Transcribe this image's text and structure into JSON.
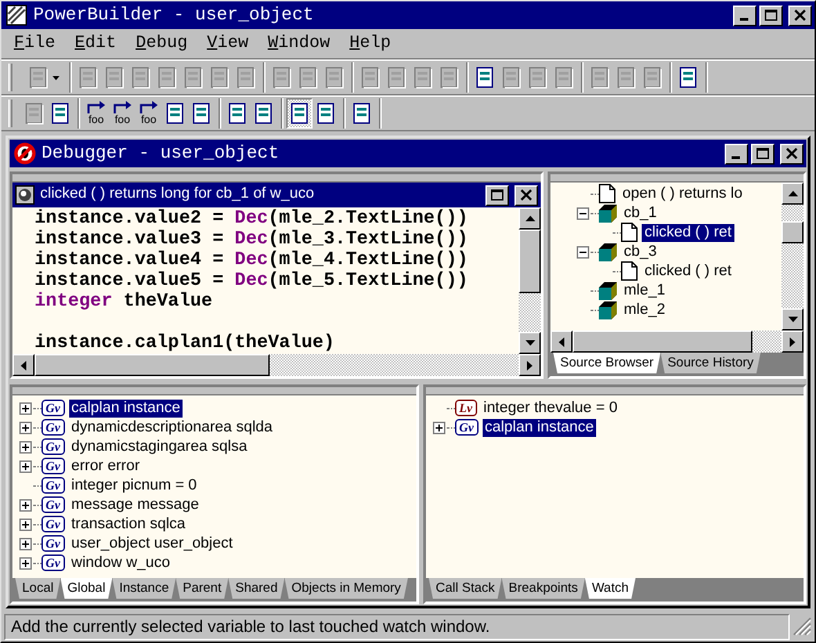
{
  "window": {
    "title": "PowerBuilder - user_object"
  },
  "menu": [
    {
      "label": "File"
    },
    {
      "label": "Edit"
    },
    {
      "label": "Debug"
    },
    {
      "label": "View"
    },
    {
      "label": "Window"
    },
    {
      "label": "Help"
    }
  ],
  "toolbars": [
    {
      "groups": [
        [
          {
            "disabled": true,
            "dropdown": true
          }
        ],
        [
          {
            "disabled": true
          },
          {
            "disabled": true
          },
          {
            "disabled": true
          },
          {
            "disabled": true
          },
          {
            "disabled": true
          },
          {
            "disabled": true
          },
          {
            "disabled": true
          }
        ],
        [
          {
            "disabled": true
          },
          {
            "disabled": true
          },
          {
            "disabled": true
          }
        ],
        [
          {
            "disabled": true
          },
          {
            "disabled": true
          },
          {
            "disabled": true
          },
          {
            "disabled": true
          }
        ],
        [
          {
            "disabled": false
          },
          {
            "disabled": true
          },
          {
            "disabled": true
          },
          {
            "disabled": true
          }
        ],
        [
          {
            "disabled": true
          },
          {
            "disabled": true
          },
          {
            "disabled": true
          }
        ],
        [
          {
            "disabled": false
          }
        ]
      ]
    },
    {
      "groups": [
        [
          {
            "disabled": true
          },
          {
            "disabled": false
          }
        ],
        [
          {
            "disabled": false,
            "caption": "foo"
          },
          {
            "disabled": false,
            "caption": "foo"
          },
          {
            "disabled": false,
            "caption": "foo"
          },
          {
            "disabled": false
          },
          {
            "disabled": false
          }
        ],
        [
          {
            "disabled": false
          },
          {
            "disabled": false
          }
        ],
        [
          {
            "disabled": false,
            "pressed": true
          },
          {
            "disabled": false
          }
        ],
        [
          {
            "disabled": false
          }
        ]
      ]
    }
  ],
  "debugger": {
    "title": "Debugger - user_object",
    "source": {
      "title": "clicked ( ) returns long for cb_1 of w_uco",
      "lines": [
        {
          "segments": [
            {
              "text": "instance.value2 = ",
              "kind": "plain"
            },
            {
              "text": "Dec",
              "kind": "keyword"
            },
            {
              "text": "(mle_2.TextLine())",
              "kind": "plain"
            }
          ]
        },
        {
          "segments": [
            {
              "text": "instance.value3 = ",
              "kind": "plain"
            },
            {
              "text": "Dec",
              "kind": "keyword"
            },
            {
              "text": "(mle_3.TextLine())",
              "kind": "plain"
            }
          ]
        },
        {
          "segments": [
            {
              "text": "instance.value4 = ",
              "kind": "plain"
            },
            {
              "text": "Dec",
              "kind": "keyword"
            },
            {
              "text": "(mle_4.TextLine())",
              "kind": "plain"
            }
          ]
        },
        {
          "segments": [
            {
              "text": "instance.value5 = ",
              "kind": "plain"
            },
            {
              "text": "Dec",
              "kind": "keyword"
            },
            {
              "text": "(mle_5.TextLine())",
              "kind": "plain"
            }
          ]
        },
        {
          "segments": [
            {
              "text": "integer",
              "kind": "keyword"
            },
            {
              "text": " theValue",
              "kind": "plain"
            }
          ]
        },
        {
          "blank_before": true,
          "segments": [
            {
              "text": "instance.calplan1(theValue)",
              "kind": "plain"
            }
          ]
        }
      ]
    },
    "source_browser": {
      "items": [
        {
          "label": "open ( ) returns lo",
          "kind": "event",
          "selected": false
        },
        {
          "label": "cb_1",
          "kind": "control",
          "selected": false,
          "expanded": true,
          "children": [
            {
              "label": "clicked ( ) ret",
              "kind": "event",
              "selected": true
            }
          ]
        },
        {
          "label": "cb_3",
          "kind": "control",
          "selected": false,
          "expanded": true,
          "children": [
            {
              "label": "clicked ( ) ret",
              "kind": "event",
              "selected": false
            }
          ]
        },
        {
          "label": "mle_1",
          "kind": "control",
          "selected": false
        },
        {
          "label": "mle_2",
          "kind": "control",
          "selected": false
        }
      ],
      "tabs": [
        {
          "label": "Source Browser",
          "selected": true
        },
        {
          "label": "Source History",
          "selected": false
        }
      ]
    },
    "variables": {
      "items": [
        {
          "label": "calplan instance",
          "kind": "variable",
          "badge": "Gv",
          "color": "#000080",
          "expanded": false,
          "selected": true
        },
        {
          "label": "dynamicdescriptionarea sqlda",
          "kind": "variable",
          "badge": "Gv",
          "color": "#000080",
          "expanded": false,
          "selected": false
        },
        {
          "label": "dynamicstagingarea sqlsa",
          "kind": "variable",
          "badge": "Gv",
          "color": "#000080",
          "expanded": false,
          "selected": false
        },
        {
          "label": "error error",
          "kind": "variable",
          "badge": "Gv",
          "color": "#000080",
          "expanded": false,
          "selected": false
        },
        {
          "label": "integer picnum = 0",
          "kind": "variable",
          "badge": "Gv",
          "color": "#000080",
          "selected": false
        },
        {
          "label": "message message",
          "kind": "variable",
          "badge": "Gv",
          "color": "#000080",
          "expanded": false,
          "selected": false
        },
        {
          "label": "transaction sqlca",
          "kind": "variable",
          "badge": "Gv",
          "color": "#000080",
          "expanded": false,
          "selected": false
        },
        {
          "label": "user_object user_object",
          "kind": "variable",
          "badge": "Gv",
          "color": "#000080",
          "expanded": false,
          "selected": false
        },
        {
          "label": "window w_uco",
          "kind": "variable",
          "badge": "Gv",
          "color": "#000080",
          "expanded": false,
          "selected": false
        }
      ],
      "tabs": [
        {
          "label": "Local",
          "selected": false
        },
        {
          "label": "Global",
          "selected": true
        },
        {
          "label": "Instance",
          "selected": false
        },
        {
          "label": "Parent",
          "selected": false
        },
        {
          "label": "Shared",
          "selected": false
        },
        {
          "label": "Objects in Memory",
          "selected": false
        }
      ]
    },
    "watch": {
      "items": [
        {
          "label": "integer thevalue = 0",
          "kind": "variable",
          "badge": "Lv",
          "color": "#800000",
          "selected": false
        },
        {
          "label": "calplan instance",
          "kind": "variable",
          "badge": "Gv",
          "color": "#000080",
          "expanded": false,
          "selected": true
        }
      ],
      "tabs": [
        {
          "label": "Call Stack",
          "selected": false
        },
        {
          "label": "Breakpoints",
          "selected": false
        },
        {
          "label": "Watch",
          "selected": true
        }
      ]
    }
  },
  "status_bar": {
    "text": "Add the currently selected variable to last touched watch window."
  }
}
